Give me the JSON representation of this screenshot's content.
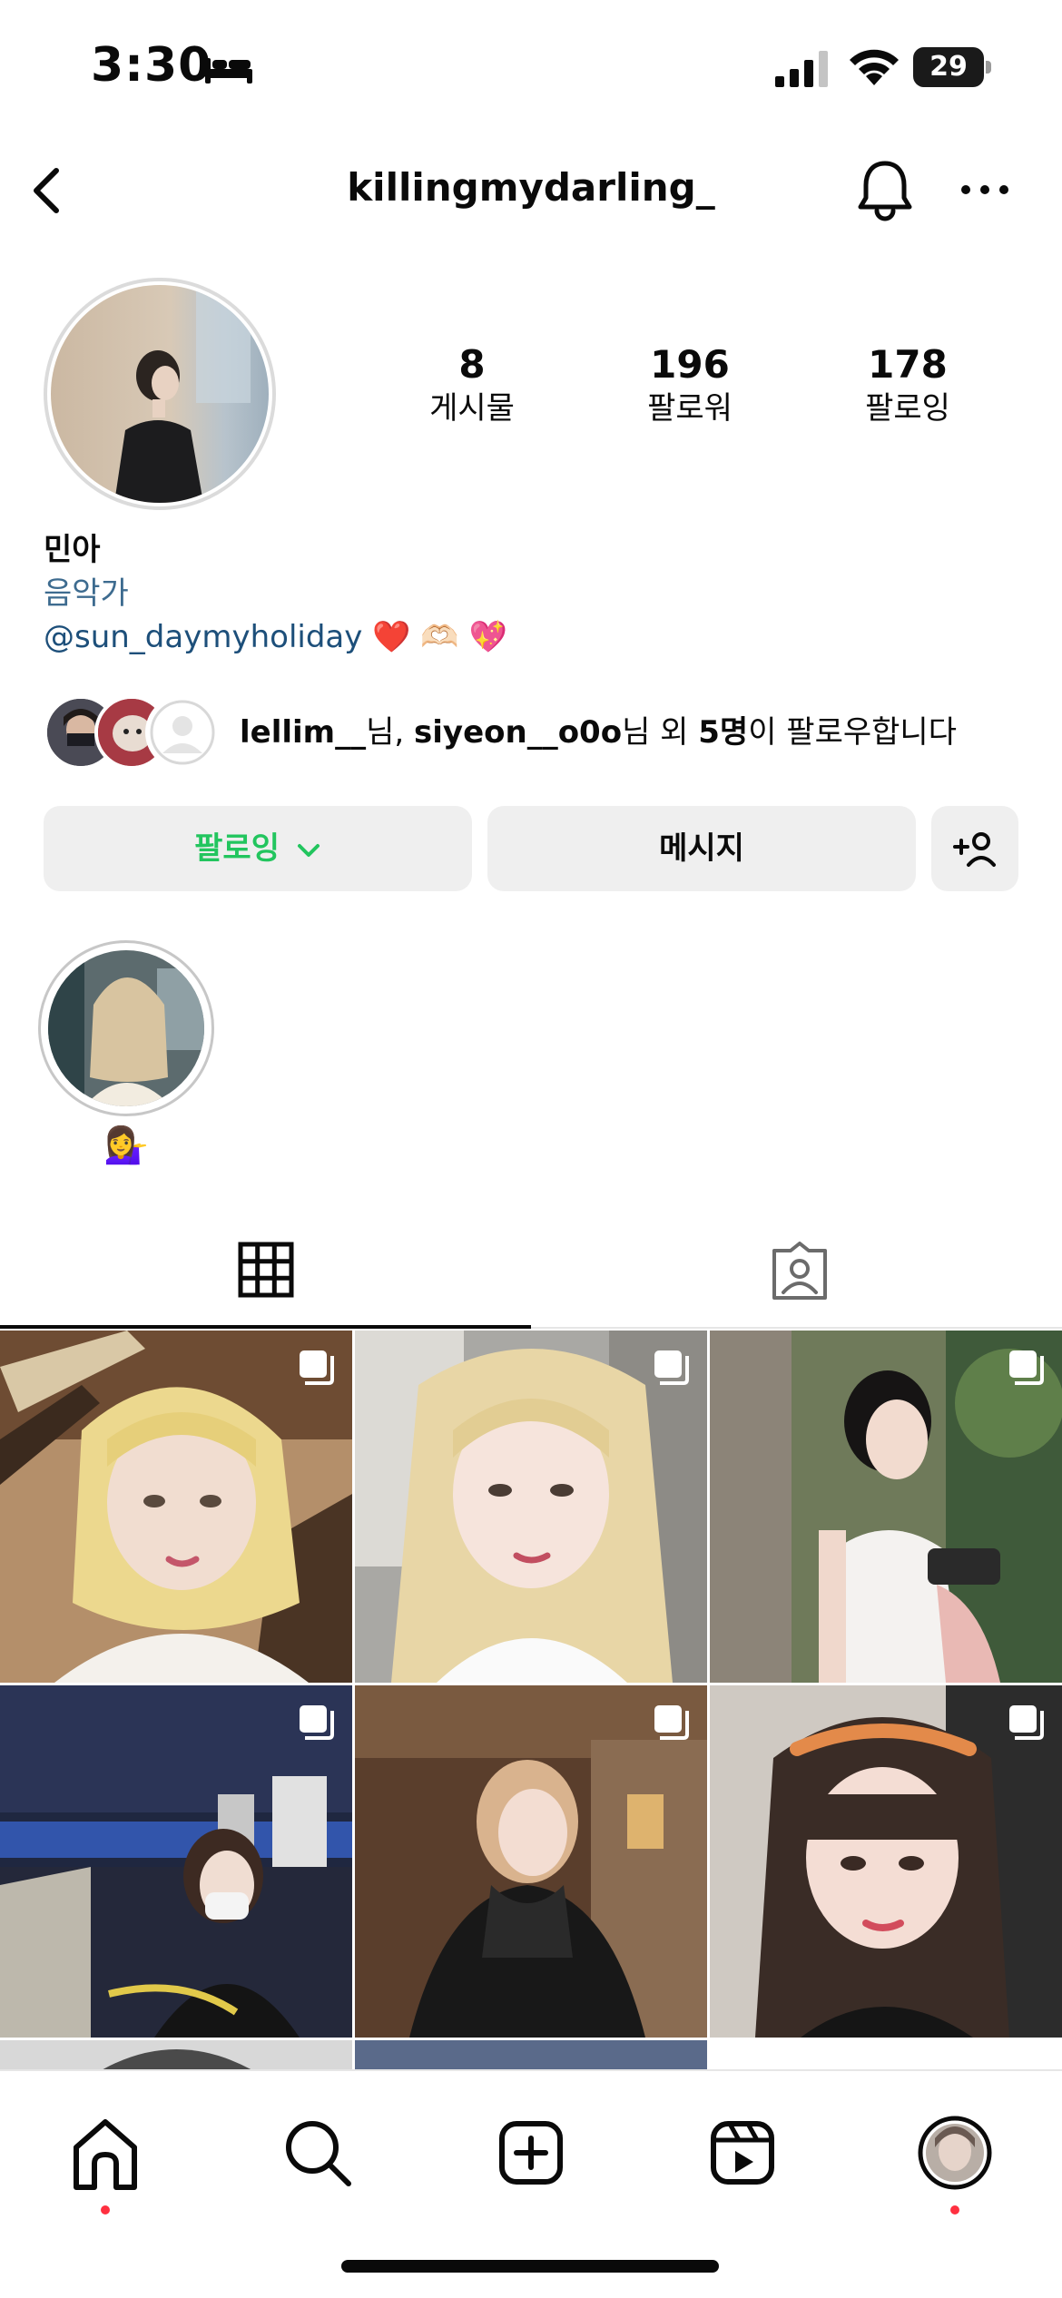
{
  "status_bar": {
    "time": "3:30",
    "battery": "29"
  },
  "header": {
    "username": "killingmydarling_",
    "icons": [
      "chevron-left-icon",
      "bell-icon",
      "more-icon"
    ]
  },
  "profile": {
    "stats": [
      {
        "value": "8",
        "label": "게시물"
      },
      {
        "value": "196",
        "label": "팔로워"
      },
      {
        "value": "178",
        "label": "팔로잉"
      }
    ],
    "name": "민아",
    "category": "음악가",
    "link": "@sun_daymyholiday",
    "link_emojis": "❤️ 🫶🏻 💖"
  },
  "mutual": {
    "user1": "lellim__",
    "sep1": "님, ",
    "user2": "siyeon__o0o",
    "sep2": "님 외 ",
    "count": "5명",
    "suffix": "이 팔로우합니다"
  },
  "actions": {
    "following_label": "팔로잉",
    "message_label": "메시지"
  },
  "highlight": {
    "label": "💁‍♀️"
  },
  "tabs": [
    "grid-icon",
    "tagged-icon"
  ],
  "grid_posts": [
    {
      "kind": "photo",
      "multi": true
    },
    {
      "kind": "photo",
      "multi": true
    },
    {
      "kind": "photo",
      "multi": true
    },
    {
      "kind": "photo",
      "multi": true
    },
    {
      "kind": "photo",
      "multi": true
    },
    {
      "kind": "photo",
      "multi": true
    }
  ],
  "bottom_nav": [
    "home-icon",
    "search-icon",
    "create-icon",
    "reels-icon",
    "profile-avatar"
  ],
  "colors": {
    "following": "#22c55e",
    "link": "#1d4f7a",
    "button_bg": "#efefef",
    "dot": "#ff3040"
  }
}
